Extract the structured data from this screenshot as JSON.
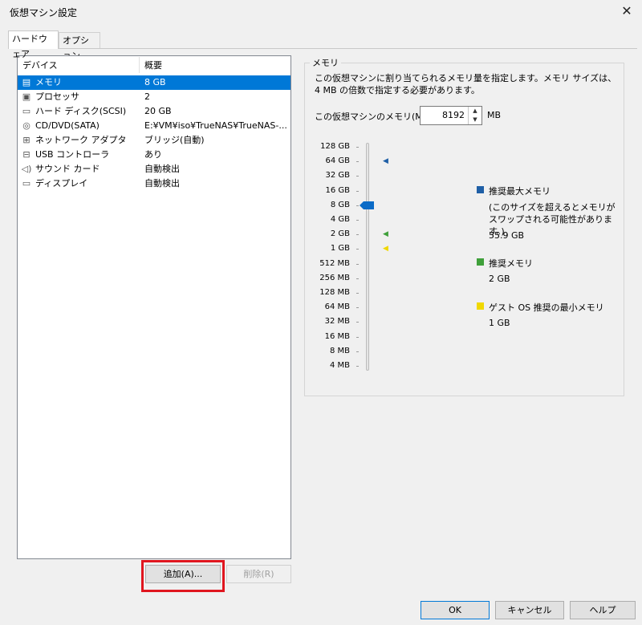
{
  "window": {
    "title": "仮想マシン設定",
    "close_glyph": "✕"
  },
  "tabs": [
    {
      "label": "ハードウェア",
      "active": true
    },
    {
      "label": "オプション",
      "active": false
    }
  ],
  "device_list": {
    "columns": [
      "デバイス",
      "概要"
    ],
    "rows": [
      {
        "icon": "memory-icon",
        "icon_glyph": "▤",
        "name": "メモリ",
        "summary": "8 GB",
        "selected": true
      },
      {
        "icon": "processor-icon",
        "icon_glyph": "▣",
        "name": "プロセッサ",
        "summary": "2",
        "selected": false
      },
      {
        "icon": "hard-disk-icon",
        "icon_glyph": "▭",
        "name": "ハード ディスク(SCSI)",
        "summary": "20 GB",
        "selected": false
      },
      {
        "icon": "cd-dvd-icon",
        "icon_glyph": "◎",
        "name": "CD/DVD(SATA)",
        "summary": "E:¥VM¥iso¥TrueNAS¥TrueNAS-...",
        "selected": false
      },
      {
        "icon": "network-adapter-icon",
        "icon_glyph": "⊞",
        "name": "ネットワーク アダプタ",
        "summary": "ブリッジ(自動)",
        "selected": false
      },
      {
        "icon": "usb-icon",
        "icon_glyph": "⊟",
        "name": "USB コントローラ",
        "summary": "あり",
        "selected": false
      },
      {
        "icon": "sound-card-icon",
        "icon_glyph": "◁)",
        "name": "サウンド カード",
        "summary": "自動検出",
        "selected": false
      },
      {
        "icon": "display-icon",
        "icon_glyph": "▭",
        "name": "ディスプレイ",
        "summary": "自動検出",
        "selected": false
      }
    ]
  },
  "list_buttons": {
    "add": "追加(A)...",
    "remove": "削除(R)"
  },
  "memory_panel": {
    "group_title": "メモリ",
    "description": "この仮想マシンに割り当てられるメモリ量を指定します。メモリ サイズは、4 MB の倍数で指定する必要があります。",
    "field_label": "この仮想マシンのメモリ(M):",
    "value": "8192",
    "unit": "MB",
    "spin_up_glyph": "▲",
    "spin_down_glyph": "▼",
    "scale_labels": [
      "128 GB",
      "64 GB",
      "32 GB",
      "16 GB",
      "8 GB",
      "4 GB",
      "2 GB",
      "1 GB",
      "512 MB",
      "256 MB",
      "128 MB",
      "64 MB",
      "32 MB",
      "16 MB",
      "8 MB",
      "4 MB"
    ],
    "current_level": "8 GB",
    "markers": [
      {
        "level": "64 GB",
        "color": "#1f5fa6",
        "glyph": "◀"
      },
      {
        "level": "2 GB",
        "color": "#3fa03a",
        "glyph": "◀"
      },
      {
        "level": "1 GB",
        "color": "#f0d800",
        "glyph": "◀"
      }
    ],
    "legend": [
      {
        "color": "#1f5fa6",
        "title": "推奨最大メモリ",
        "note": "(このサイズを超えるとメモリがスワップされる可能性があります。)",
        "value": "55.9 GB"
      },
      {
        "color": "#3fa03a",
        "title": "推奨メモリ",
        "value": "2 GB"
      },
      {
        "color": "#f0d800",
        "title": "ゲスト OS 推奨の最小メモリ",
        "value": "1 GB"
      }
    ]
  },
  "footer": {
    "ok": "OK",
    "cancel": "キャンセル",
    "help": "ヘルプ"
  }
}
